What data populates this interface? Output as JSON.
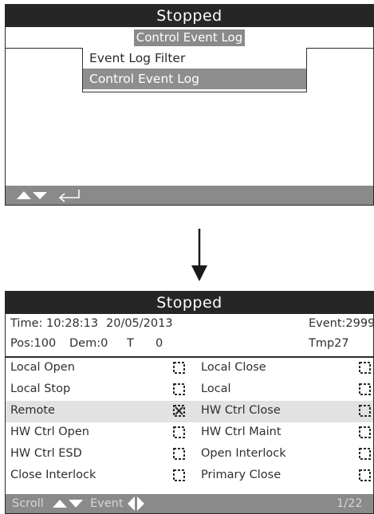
{
  "screen1": {
    "title": "Stopped",
    "subtitle": "Control Event Log",
    "menu": [
      {
        "label": "Event Log Filter",
        "selected": false
      },
      {
        "label": "Control Event Log",
        "selected": true
      }
    ],
    "footer_icons": [
      "up-arrow-icon",
      "down-arrow-icon",
      "enter-return-icon"
    ]
  },
  "screen2": {
    "title": "Stopped",
    "time_label": "Time: 10:28:13",
    "date": "20/05/2013",
    "event_label": "Event:2999",
    "pos": "Pos:100",
    "dem": "Dem:0",
    "t_label": "T",
    "t_value": "0",
    "tmp": "Tmp27",
    "rows": [
      {
        "left": "Local Open",
        "left_checked": false,
        "right": "Local Close",
        "right_checked": false,
        "highlight": false
      },
      {
        "left": "Local Stop",
        "left_checked": false,
        "right": "Local",
        "right_checked": false,
        "highlight": false
      },
      {
        "left": "Remote",
        "left_checked": true,
        "right": "HW Ctrl Close",
        "right_checked": false,
        "highlight": true
      },
      {
        "left": "HW Ctrl Open",
        "left_checked": false,
        "right": "HW Ctrl Maint",
        "right_checked": false,
        "highlight": false
      },
      {
        "left": "HW Ctrl ESD",
        "left_checked": false,
        "right": "Open Interlock",
        "right_checked": false,
        "highlight": false
      },
      {
        "left": "Close Interlock",
        "left_checked": false,
        "right": "Primary Close",
        "right_checked": false,
        "highlight": false
      }
    ],
    "footer": {
      "scroll_label": "Scroll",
      "event_label": "Event",
      "page": "1/22"
    }
  }
}
